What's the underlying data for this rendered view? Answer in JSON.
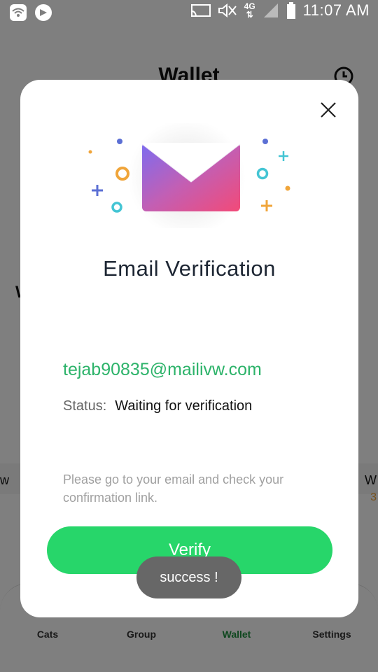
{
  "status_bar": {
    "time": "11:07 AM",
    "network": "4G"
  },
  "app": {
    "title": "Wallet",
    "peek_left_text": "W",
    "peek_right_text": "W",
    "peek_right_num": "3",
    "peek_left_small": "w"
  },
  "nav": {
    "items": [
      {
        "label": "Cats"
      },
      {
        "label": "Group"
      },
      {
        "label": "Wallet"
      },
      {
        "label": "Settings"
      }
    ],
    "active": "Wallet"
  },
  "modal": {
    "title": "Email Verification",
    "email": "tejab90835@mailivw.com",
    "status_label": "Status:",
    "status_value": "Waiting for verification",
    "hint": "Please go to your email and check your confirmation link.",
    "verify_label": "Verify"
  },
  "toast": {
    "text": "success !"
  },
  "icons": {
    "close": "close-icon",
    "envelope": "envelope-icon",
    "history": "history-icon"
  },
  "colors": {
    "accent_green": "#27d66a",
    "email_green": "#2db36a",
    "active_nav": "#1f8f3f"
  }
}
